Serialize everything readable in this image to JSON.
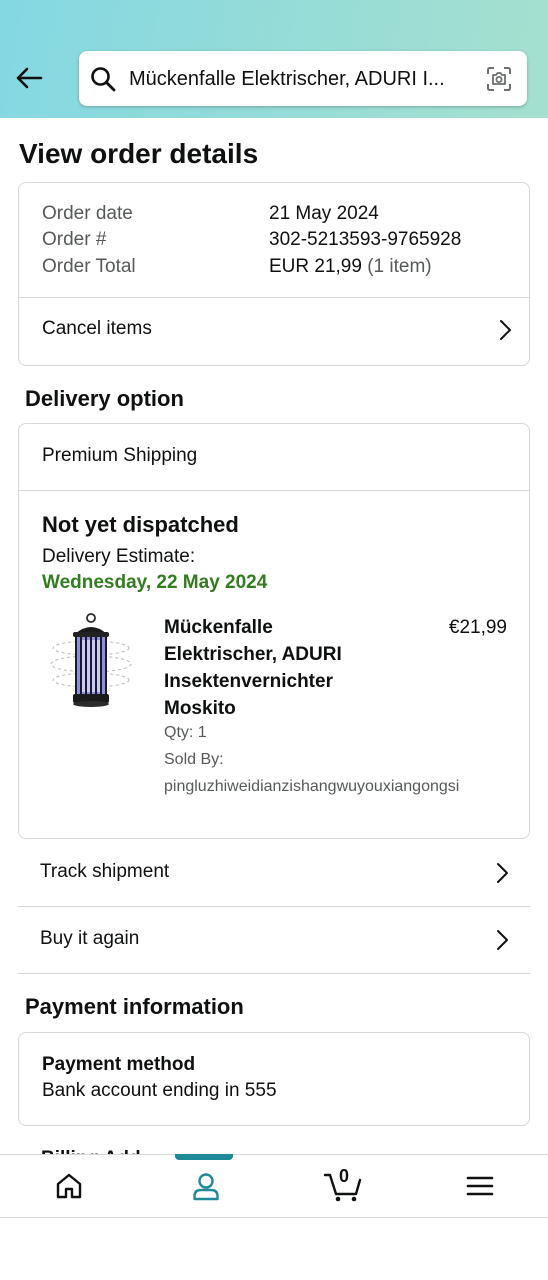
{
  "header": {
    "search_value": "Mückenfalle Elektrischer, ADURI I...",
    "icons": {
      "back": "back-arrow-icon",
      "search": "search-icon",
      "camera": "camera-scan-icon"
    }
  },
  "page": {
    "title": "View order details"
  },
  "order_summary": {
    "date_label": "Order date",
    "date_value": "21 May 2024",
    "number_label": "Order #",
    "number_value": "302-5213593-9765928",
    "total_label": "Order Total",
    "total_value": "EUR 21,99",
    "total_items": "(1 item)",
    "cancel_label": "Cancel items"
  },
  "delivery": {
    "section_title": "Delivery option",
    "shipping_method": "Premium Shipping",
    "status": "Not yet dispatched",
    "estimate_label": "Delivery Estimate:",
    "estimate_date": "Wednesday, 22 May 2024",
    "product": {
      "name": "Mückenfalle Elektrischer, ADURI Insektenvernichter Moskito",
      "price": "€21,99",
      "qty": "Qty: 1",
      "sold_by_label": "Sold By:",
      "seller": "pingluzhiweidianzishangwuyouxiangongsi"
    },
    "track_label": "Track shipment",
    "buy_again_label": "Buy it again"
  },
  "payment": {
    "section_title": "Payment information",
    "method_title": "Payment method",
    "method_value": "Bank account ending in 555",
    "billing_peek": "Billing Add"
  },
  "bottom_nav": {
    "cart_count": "0",
    "items": [
      "home-icon",
      "account-icon",
      "cart-icon",
      "menu-icon"
    ],
    "active": "account-icon"
  },
  "colors": {
    "header_gradient_start": "#84d8e3",
    "header_gradient_end": "#a5e0cf",
    "delivery_green": "#327d1f",
    "nav_accent": "#1f8a97",
    "border": "#d5d9d9"
  }
}
